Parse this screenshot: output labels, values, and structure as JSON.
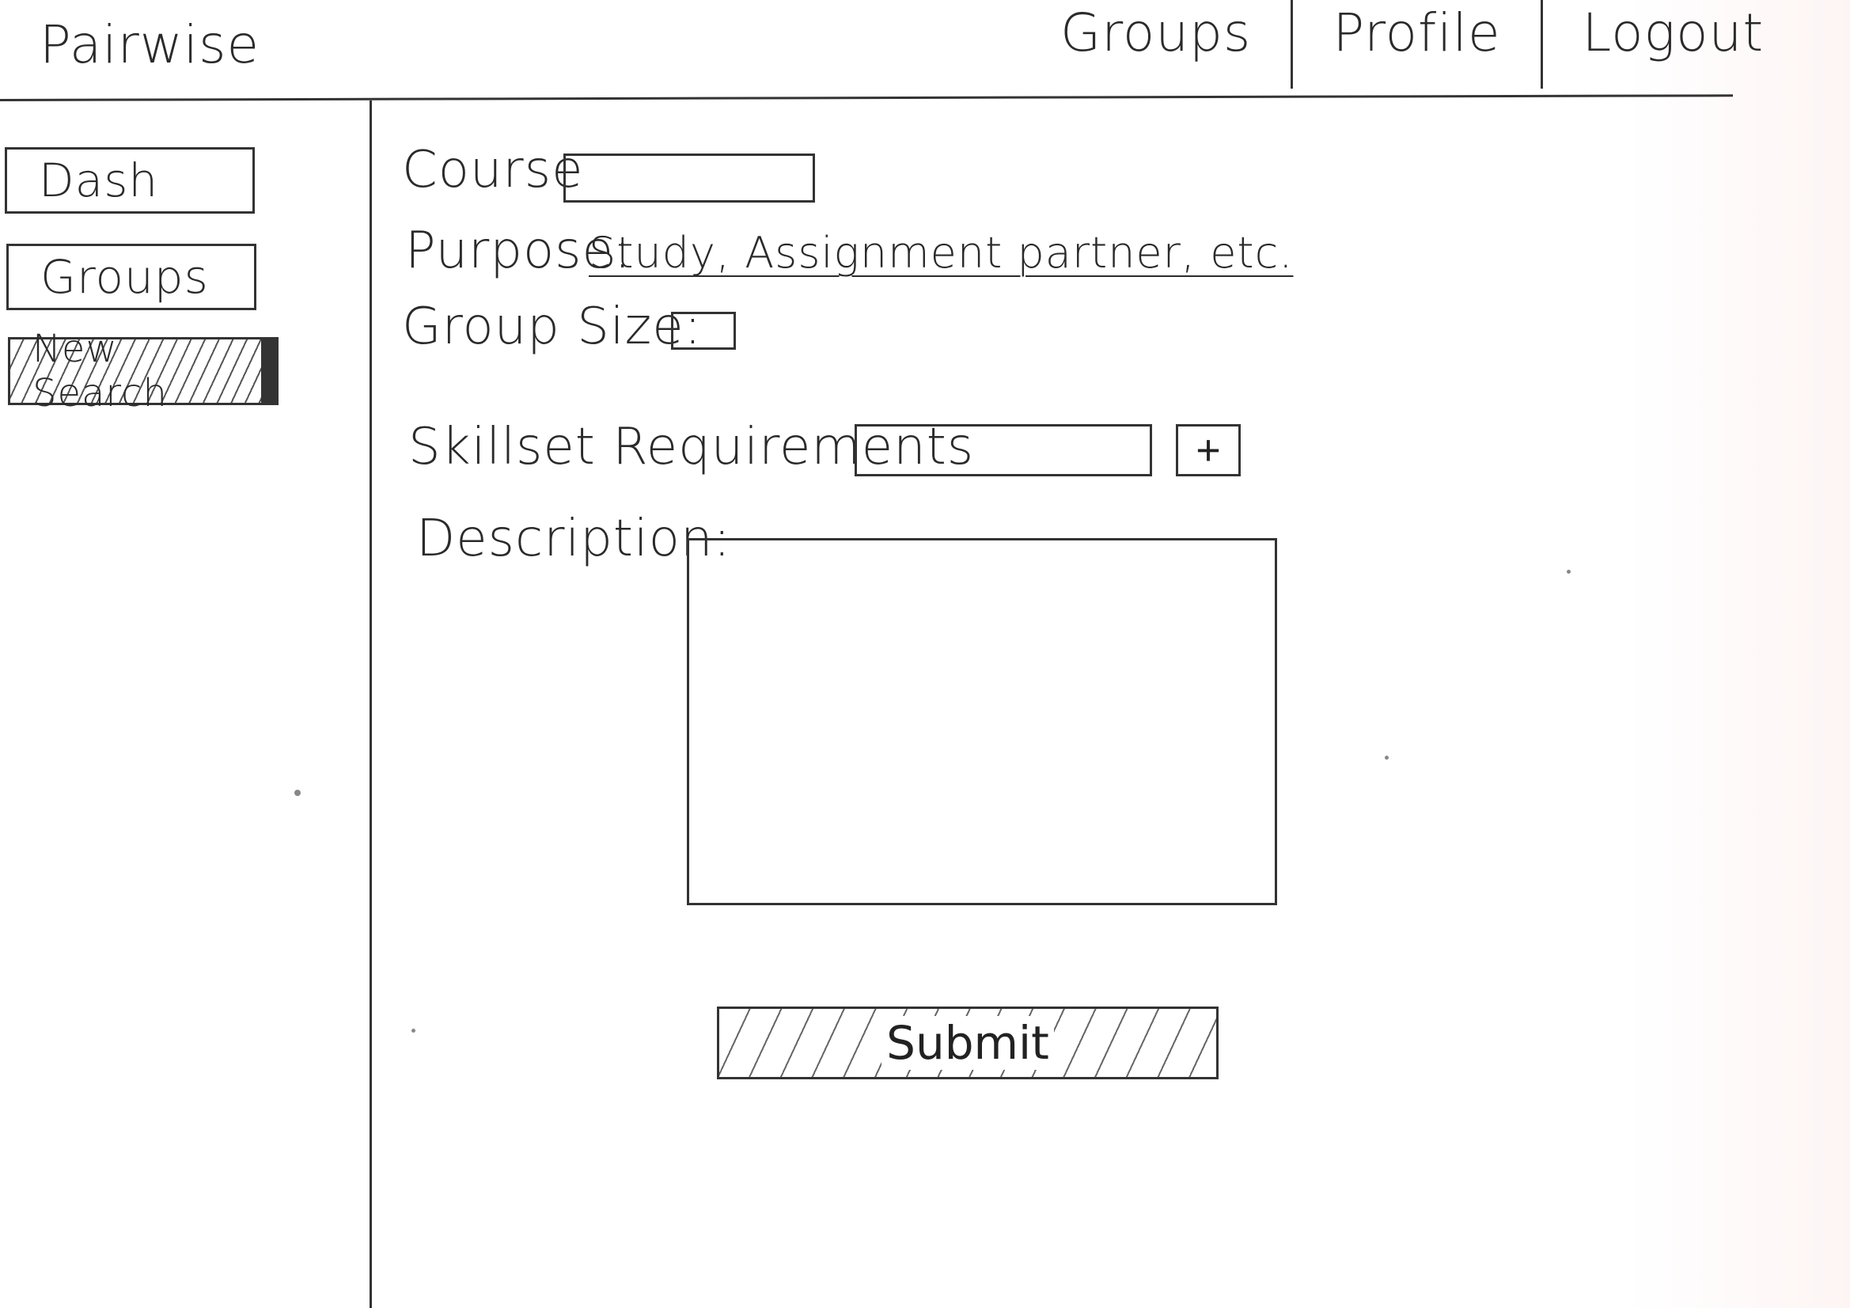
{
  "header": {
    "brand": "Pairwise",
    "nav": [
      {
        "label": "Groups"
      },
      {
        "label": "Profile"
      },
      {
        "label": "Logout"
      }
    ]
  },
  "sidebar": {
    "items": [
      {
        "label": "Dash",
        "active": false
      },
      {
        "label": "Groups",
        "active": false
      },
      {
        "label": "New Search",
        "active": true
      }
    ]
  },
  "form": {
    "course_label": "Course",
    "purpose_label": "Purpose:",
    "purpose_options": "Study, Assignment partner, etc.",
    "group_size_label": "Group Size:",
    "skillset_label": "Skillset Requirements",
    "add_skill_label": "+",
    "description_label": "Description:",
    "submit_label": "Submit"
  }
}
